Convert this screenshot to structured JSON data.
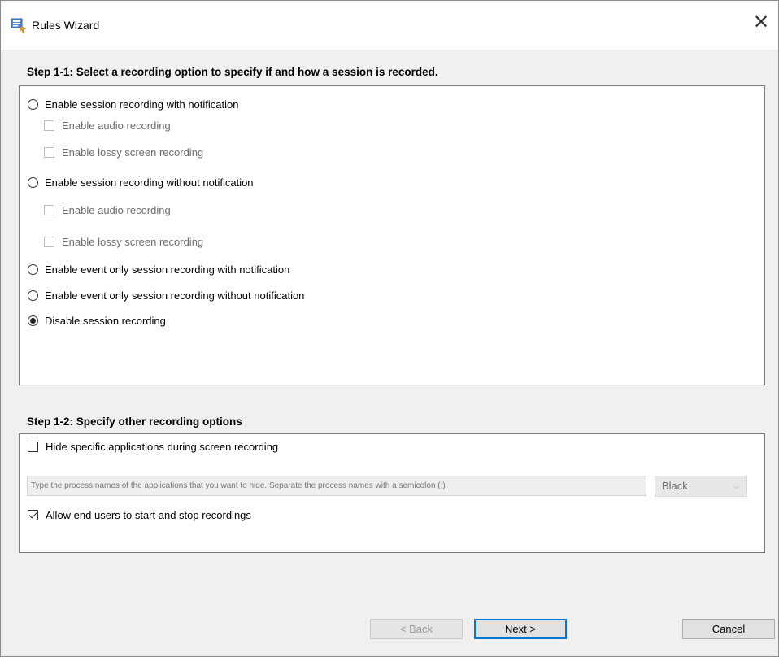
{
  "window": {
    "title": "Rules Wizard",
    "close_glyph": "✕"
  },
  "step1": {
    "title": "Step 1-1: Select a recording option to specify if and how a session is recorded.",
    "options": [
      {
        "type": "radio",
        "label": "Enable session recording with notification",
        "checked": false,
        "enabled": true
      },
      {
        "type": "checkbox",
        "label": "Enable audio recording",
        "checked": false,
        "enabled": false
      },
      {
        "type": "checkbox",
        "label": "Enable lossy screen recording",
        "checked": false,
        "enabled": false
      },
      {
        "type": "radio",
        "label": "Enable session recording without notification",
        "checked": false,
        "enabled": true
      },
      {
        "type": "checkbox",
        "label": "Enable audio recording",
        "checked": false,
        "enabled": false
      },
      {
        "type": "checkbox",
        "label": "Enable lossy screen recording",
        "checked": false,
        "enabled": false
      },
      {
        "type": "radio",
        "label": "Enable event only session recording with notification",
        "checked": false,
        "enabled": true
      },
      {
        "type": "radio",
        "label": "Enable event only session recording without notification",
        "checked": false,
        "enabled": true
      },
      {
        "type": "radio",
        "label": "Disable session recording",
        "checked": true,
        "enabled": true
      }
    ]
  },
  "step2": {
    "title": "Step 1-2: Specify other recording options",
    "hide_apps": {
      "label": "Hide specific applications during screen recording",
      "checked": false
    },
    "process_input": {
      "value": "",
      "placeholder": "Type the process names of the applications that you want to hide. Separate the process names with a semicolon (;)"
    },
    "color_select": {
      "value": "Black",
      "chevron": "⌵"
    },
    "allow_users": {
      "label": "Allow end users to start and stop recordings",
      "checked": true
    }
  },
  "buttons": {
    "back": "< Back",
    "next": "Next >",
    "cancel": "Cancel"
  },
  "icons": {
    "app": "rules-wizard-app-icon",
    "close": "close-icon"
  }
}
